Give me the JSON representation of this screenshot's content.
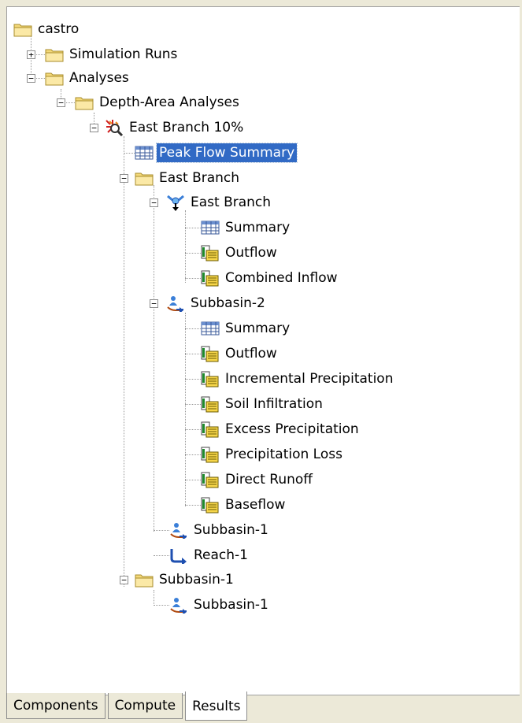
{
  "tree": {
    "root": "castro",
    "simulation_runs": "Simulation Runs",
    "analyses": "Analyses",
    "depth_area_analyses": "Depth-Area Analyses",
    "east_branch_10": "East Branch 10%",
    "peak_flow_summary": "Peak Flow Summary",
    "east_branch_folder": "East Branch",
    "east_branch_junction": "East Branch",
    "eb_summary": "Summary",
    "eb_outflow": "Outflow",
    "eb_combined_inflow": "Combined Inflow",
    "subbasin2": "Subbasin-2",
    "sb2_summary": "Summary",
    "sb2_outflow": "Outflow",
    "sb2_incremental_precip": "Incremental Precipitation",
    "sb2_soil_infiltration": "Soil Infiltration",
    "sb2_excess_precip": "Excess Precipitation",
    "sb2_precip_loss": "Precipitation Loss",
    "sb2_direct_runoff": "Direct Runoff",
    "sb2_baseflow": "Baseflow",
    "subbasin1_a": "Subbasin-1",
    "reach1": "Reach-1",
    "subbasin1_folder": "Subbasin-1",
    "subbasin1_b": "Subbasin-1"
  },
  "tabs": {
    "components": "Components",
    "compute": "Compute",
    "results": "Results",
    "active": "Results"
  },
  "icons": {
    "folder": "folder-icon",
    "table": "table-icon",
    "timeseries": "timeseries-icon",
    "subbasin": "subbasin-icon",
    "junction": "junction-icon",
    "reach": "reach-icon",
    "analysis": "analysis-icon"
  },
  "colors": {
    "selection": "#316ac5",
    "folder": "#f4d97a"
  }
}
